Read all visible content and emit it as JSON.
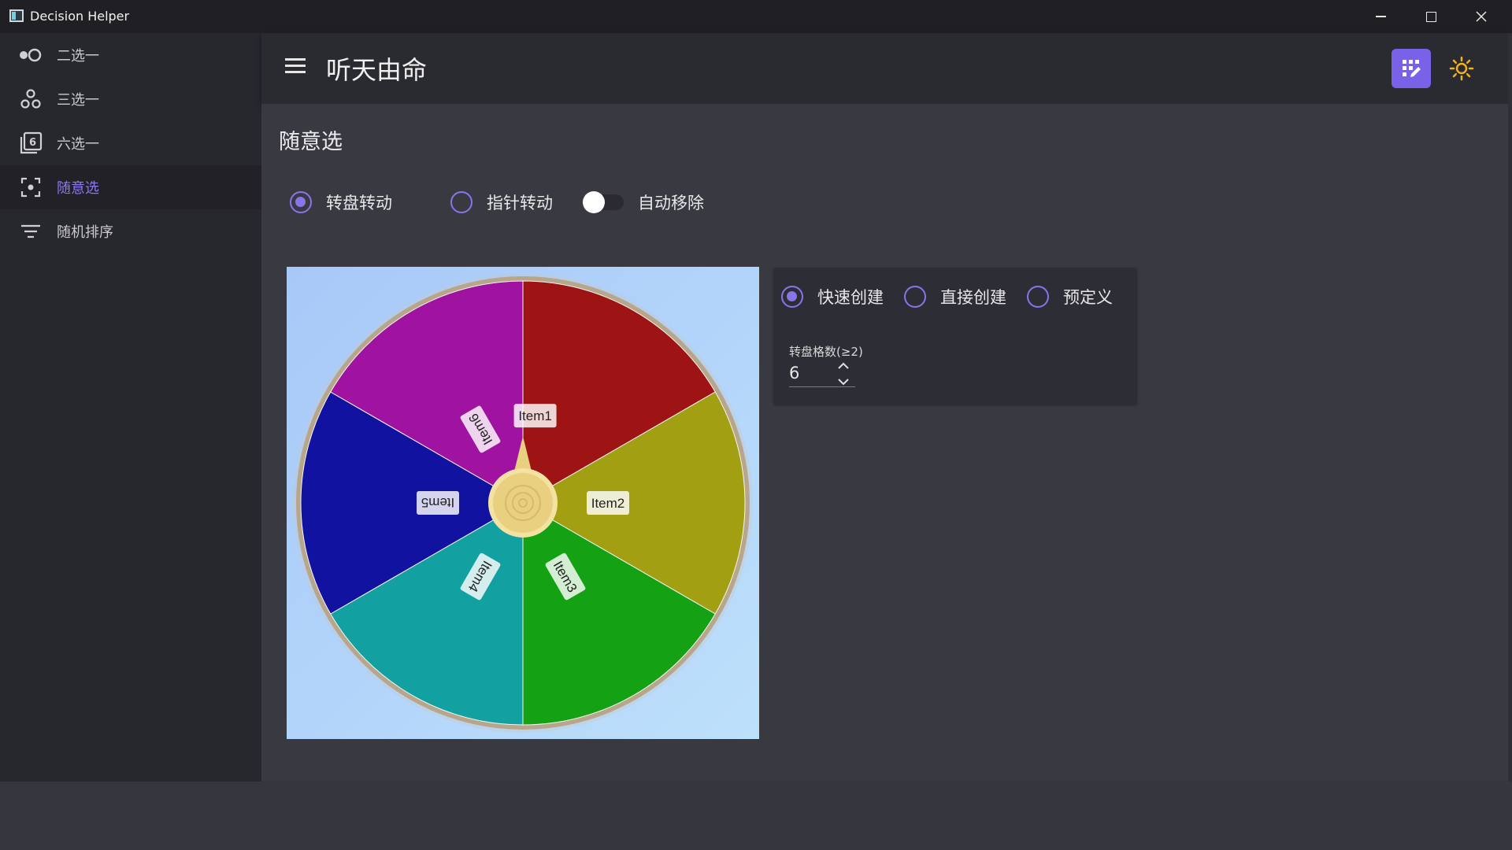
{
  "window": {
    "title": "Decision Helper"
  },
  "sidebar": {
    "items": [
      {
        "label": "二选一",
        "icon": "toggle-dots-icon",
        "active": false
      },
      {
        "label": "三选一",
        "icon": "three-circles-icon",
        "active": false
      },
      {
        "label": "六选一",
        "icon": "six-box-icon",
        "active": false
      },
      {
        "label": "随意选",
        "icon": "focus-frame-icon",
        "active": true
      },
      {
        "label": "随机排序",
        "icon": "filter-lines-icon",
        "active": false
      }
    ]
  },
  "header": {
    "title": "听天由命",
    "accent": "#7a62e8",
    "sun_color": "#f2b21e"
  },
  "main": {
    "section_title": "随意选",
    "mode_options": [
      {
        "label": "转盘转动",
        "checked": true
      },
      {
        "label": "指针转动",
        "checked": false
      }
    ],
    "auto_remove": {
      "label": "自动移除",
      "on": false
    },
    "create_options": [
      {
        "label": "快速创建",
        "checked": true
      },
      {
        "label": "直接创建",
        "checked": false
      },
      {
        "label": "预定义",
        "checked": false
      }
    ],
    "count": {
      "label": "转盘格数(≥2)",
      "value": "6"
    }
  },
  "wheel": {
    "segments": [
      {
        "label": "Item1",
        "color": "#9e1414"
      },
      {
        "label": "Item2",
        "color": "#a2a012"
      },
      {
        "label": "Item3",
        "color": "#14a214"
      },
      {
        "label": "Item4",
        "color": "#12a0a0"
      },
      {
        "label": "Item5",
        "color": "#1212a0"
      },
      {
        "label": "Item6",
        "color": "#a012a0"
      }
    ],
    "rim_color": "#b8a68a",
    "hub_color": "#e9cf80"
  }
}
